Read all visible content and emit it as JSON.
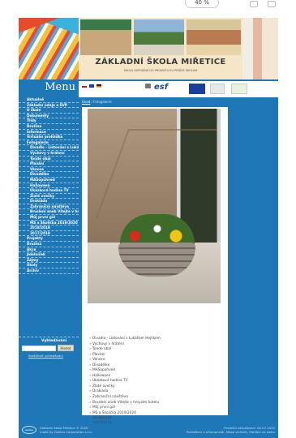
{
  "browser": {
    "zoom_label": "40 %"
  },
  "header": {
    "title": "ZÁKLADNÍ ŠKOLA MIŘETICE",
    "subtitle": "ŠKOLA ZAPOJENÁ DO PROJEKTU EU PENÍZE ŠKOLÁM"
  },
  "menu_title": "Menu",
  "sidebar": {
    "items": [
      {
        "label": "Aktuálně",
        "sub": false
      },
      {
        "label": "Základní údaje a ŠVP",
        "sub": false
      },
      {
        "label": "O škole",
        "sub": false
      },
      {
        "label": "Dokumenty",
        "sub": false
      },
      {
        "label": "Třídy",
        "sub": false
      },
      {
        "label": "Družina",
        "sub": false
      },
      {
        "label": "Informace",
        "sub": false
      },
      {
        "label": "Virtuální prohlídka",
        "sub": false
      },
      {
        "label": "Fotogalerie",
        "sub": false
      },
      {
        "label": "Divadlo - Listování s Lukášem Hejlíkem",
        "sub": true
      },
      {
        "label": "Výchovy v hrátení",
        "sub": true
      },
      {
        "label": "Tonde obal",
        "sub": true
      },
      {
        "label": "Plavání",
        "sub": true
      },
      {
        "label": "Vánoce",
        "sub": true
      },
      {
        "label": "Divadélko",
        "sub": true
      },
      {
        "label": "MASopohved",
        "sub": true
      },
      {
        "label": "Halloween",
        "sub": true
      },
      {
        "label": "Ukázková hodina TV",
        "sub": true
      },
      {
        "label": "Zlaté ovečky",
        "sub": true
      },
      {
        "label": "Drakiáda",
        "sub": true
      },
      {
        "label": "Zahraniční návštěva",
        "sub": true
      },
      {
        "label": "Bruslení aneb Vítejte v hmyzím hotelu",
        "sub": true
      },
      {
        "label": "Můj první gól",
        "sub": true
      },
      {
        "label": "MŠ a Školička 2019/2020",
        "sub": true
      },
      {
        "label": "2018/2019",
        "sub": true
      },
      {
        "label": "2017/2018",
        "sub": true
      },
      {
        "label": "Projekty",
        "sub": false
      },
      {
        "label": "Družina",
        "sub": false
      },
      {
        "label": "Akce",
        "sub": false
      },
      {
        "label": "Jídelníček",
        "sub": false
      },
      {
        "label": "Zájmy",
        "sub": false
      },
      {
        "label": "Úkoly",
        "sub": false
      },
      {
        "label": "Archiv",
        "sub": false
      }
    ]
  },
  "search": {
    "label": "Vyhledávání",
    "button": "Hledat",
    "advanced": "Rozšířené vyhledávání"
  },
  "breadcrumb": {
    "home": "Úvod",
    "sep": "/",
    "current": "Fotogalerie"
  },
  "gallery_list": [
    "Divadlo - Listování s Lukášem Hejlíkem",
    "Výchovy v hrátení",
    "Tonde obal",
    "Plavání",
    "Vánoce",
    "Divadélko",
    "MASopohved",
    "Halloween",
    "Ukázková hodina TV",
    "Zlaté ovečky",
    "Drakiáda",
    "Zahraniční návštěva",
    "Bruslení aneb Vítejte v hmyzím hotelu",
    "Můj první gól",
    "MŠ a Školička 2019/2020",
    "2018/2019",
    "2017/2018"
  ],
  "footer": {
    "logo": "Galileo",
    "left_line1": "Základní škola Miřetice © 2020",
    "left_line2": "made by Galileo Corporation s.r.o.",
    "right_line1": "Poslední aktualizace: 02.07.2020",
    "right_line2": "Prohlášení o přístupnosti, Mapa stránek, Hledání na webu"
  }
}
